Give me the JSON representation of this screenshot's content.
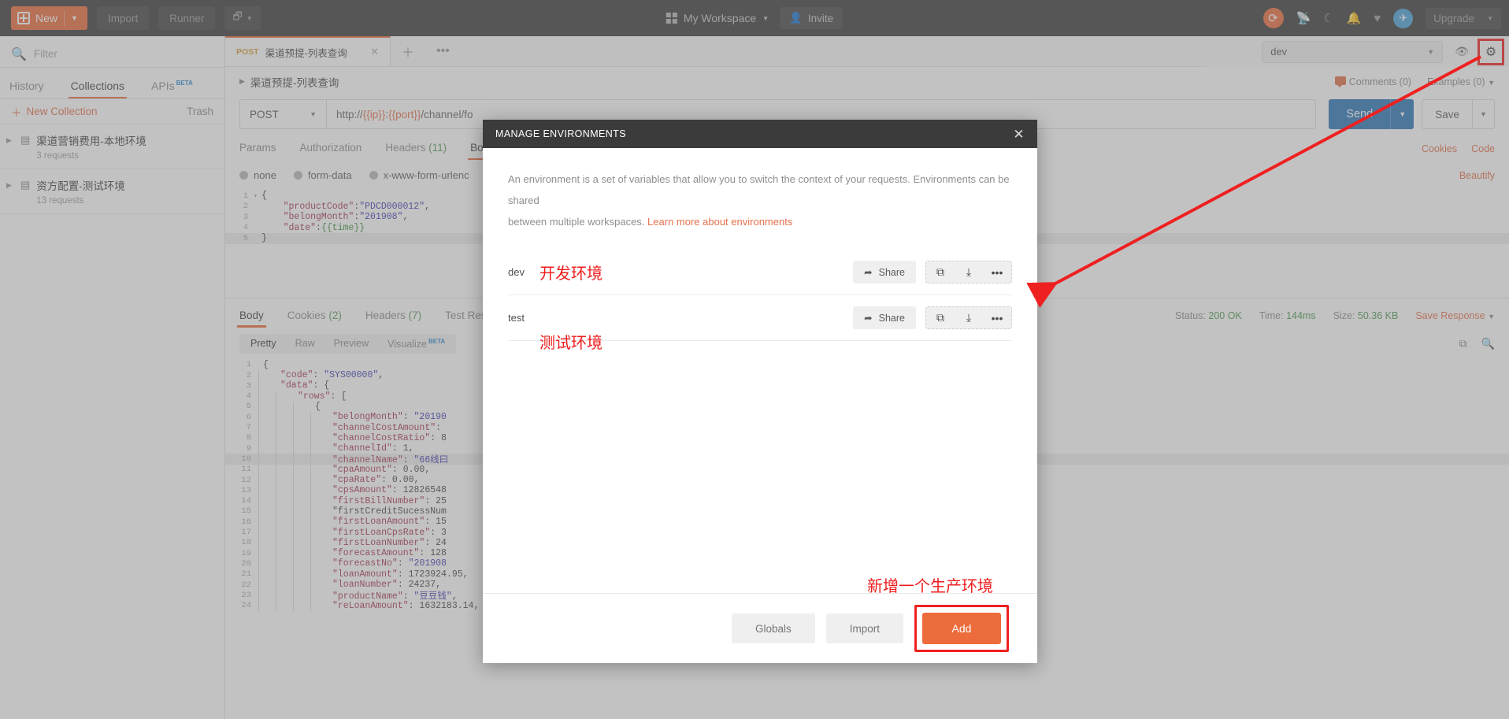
{
  "topbar": {
    "new_label": "New",
    "import_label": "Import",
    "runner_label": "Runner",
    "workspace_label": "My Workspace",
    "invite_label": "Invite",
    "upgrade_label": "Upgrade",
    "icons": [
      "sync-icon",
      "satellite-icon",
      "moon-icon",
      "bell-icon",
      "heart-icon",
      "avatar-icon"
    ]
  },
  "sidebar": {
    "filter_placeholder": "Filter",
    "tabs": [
      {
        "label": "History",
        "active": false
      },
      {
        "label": "Collections",
        "active": true
      },
      {
        "label": "APIs",
        "badge": "BETA",
        "active": false
      }
    ],
    "new_collection_label": "New Collection",
    "trash_label": "Trash",
    "collections": [
      {
        "name": "渠道营销费用-本地环境",
        "sub": "3 requests"
      },
      {
        "name": "资方配置-测试环境",
        "sub": "13 requests"
      }
    ]
  },
  "request": {
    "tab": {
      "method": "POST",
      "name": "渠道预提-列表查询"
    },
    "breadcrumb": "渠道预提-列表查询",
    "comments_label": "Comments (0)",
    "examples_label": "Examples (0)",
    "method": "POST",
    "url_prefix": "http://",
    "url_var1": "{{ip}}",
    "url_mid": ":",
    "url_var2": "{{port}}",
    "url_suffix": "/channel/fo",
    "send_label": "Send",
    "save_label": "Save",
    "tabs": [
      {
        "label": "Params",
        "active": false
      },
      {
        "label": "Authorization",
        "active": false
      },
      {
        "label": "Headers",
        "count": "(11)",
        "active": false
      },
      {
        "label": "Bo",
        "active": true
      }
    ],
    "cookies_label": "Cookies",
    "code_label": "Code",
    "body_types": [
      "none",
      "form-data",
      "x-www-form-urlenc"
    ],
    "beautify_label": "Beautify",
    "body_lines": [
      {
        "n": "1",
        "fold": "▾",
        "text": "{"
      },
      {
        "n": "2",
        "fold": "",
        "text": "    \"productCode\":\"PDCD000012\","
      },
      {
        "n": "3",
        "fold": "",
        "text": "    \"belongMonth\":\"201908\","
      },
      {
        "n": "4",
        "fold": "",
        "text": "    \"date\":{{time}}"
      },
      {
        "n": "5",
        "fold": "",
        "text": "}"
      }
    ]
  },
  "response": {
    "tabs": [
      {
        "label": "Body",
        "active": true
      },
      {
        "label": "Cookies",
        "count": "(2)",
        "active": false
      },
      {
        "label": "Headers",
        "count": "(7)",
        "active": false
      },
      {
        "label": "Test Results",
        "active": false
      }
    ],
    "status_label": "Status:",
    "status_value": "200 OK",
    "time_label": "Time:",
    "time_value": "144ms",
    "size_label": "Size:",
    "size_value": "50.36 KB",
    "save_response_label": "Save Response",
    "view_tabs": [
      {
        "label": "Pretty",
        "active": true
      },
      {
        "label": "Raw",
        "active": false
      },
      {
        "label": "Preview",
        "active": false
      },
      {
        "label": "Visualize",
        "badge": "BETA",
        "active": false
      }
    ],
    "lines": [
      {
        "n": "1",
        "depth": 0,
        "text": "{"
      },
      {
        "n": "2",
        "depth": 1,
        "text": "\"code\": \"SYS00000\","
      },
      {
        "n": "3",
        "depth": 1,
        "text": "\"data\": {"
      },
      {
        "n": "4",
        "depth": 2,
        "text": "\"rows\": ["
      },
      {
        "n": "5",
        "depth": 3,
        "text": "{"
      },
      {
        "n": "6",
        "depth": 4,
        "text": "\"belongMonth\": \"20190"
      },
      {
        "n": "7",
        "depth": 4,
        "text": "\"channelCostAmount\": "
      },
      {
        "n": "8",
        "depth": 4,
        "text": "\"channelCostRatio\": 8"
      },
      {
        "n": "9",
        "depth": 4,
        "text": "\"channelId\": 1,"
      },
      {
        "n": "10",
        "depth": 4,
        "text": "\"channelName\": \"66线曰"
      },
      {
        "n": "11",
        "depth": 4,
        "text": "\"cpaAmount\": 0.00,"
      },
      {
        "n": "12",
        "depth": 4,
        "text": "\"cpaRate\": 0.00,"
      },
      {
        "n": "13",
        "depth": 4,
        "text": "\"cpsAmount\": 12826548"
      },
      {
        "n": "14",
        "depth": 4,
        "text": "\"firstBillNumber\": 25"
      },
      {
        "n": "15",
        "depth": 4,
        "text": "\"firstCreditSucessNum"
      },
      {
        "n": "16",
        "depth": 4,
        "text": "\"firstLoanAmount\": 15"
      },
      {
        "n": "17",
        "depth": 4,
        "text": "\"firstLoanCpsRate\": 3"
      },
      {
        "n": "18",
        "depth": 4,
        "text": "\"firstLoanNumber\": 24"
      },
      {
        "n": "19",
        "depth": 4,
        "text": "\"forecastAmount\": 128"
      },
      {
        "n": "20",
        "depth": 4,
        "text": "\"forecastNo\": \"201908"
      },
      {
        "n": "21",
        "depth": 4,
        "text": "\"loanAmount\": 1723924.95,"
      },
      {
        "n": "22",
        "depth": 4,
        "text": "\"loanNumber\": 24237,"
      },
      {
        "n": "23",
        "depth": 4,
        "text": "\"productName\": \"豆豆钱\","
      },
      {
        "n": "24",
        "depth": 4,
        "text": "\"reLoanAmount\": 1632183.14,"
      }
    ]
  },
  "env_bar": {
    "selected": "dev",
    "eye_icon": "eye-icon",
    "gear_icon": "gear-icon"
  },
  "modal": {
    "title": "MANAGE ENVIRONMENTS",
    "desc_part1": "An environment is a set of variables that allow you to switch the context of your requests. Environments can be shared",
    "desc_part2": "between multiple workspaces.",
    "desc_link": "Learn more about environments",
    "share_label": "Share",
    "row_icons": [
      "copy-icon",
      "download-icon",
      "more-icon"
    ],
    "environments": [
      {
        "name": "dev",
        "annotation": "开发环境",
        "annotation_below": false
      },
      {
        "name": "test",
        "annotation": "测试环境",
        "annotation_below": true
      }
    ],
    "globals_label": "Globals",
    "import_label": "Import",
    "add_label": "Add",
    "add_annotation": "新增一个生产环境"
  },
  "colors": {
    "accent": "#ec6c3c",
    "send": "#2b76b9",
    "annotation_red": "#ee1c1c",
    "topbar_bg": "#3b3b3b"
  }
}
